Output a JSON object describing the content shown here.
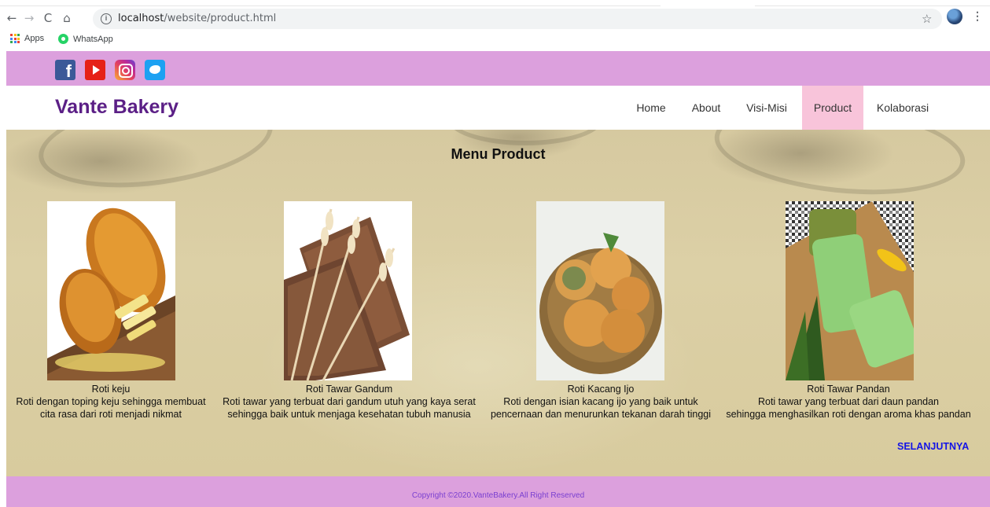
{
  "browser": {
    "url_host": "localhost",
    "url_path": "/website/product.html",
    "bookmarks": [
      {
        "label": "Apps"
      },
      {
        "label": "WhatsApp"
      }
    ]
  },
  "site": {
    "brand": "Vante Bakery",
    "nav": [
      {
        "label": "Home"
      },
      {
        "label": "About"
      },
      {
        "label": "Visi-Misi"
      },
      {
        "label": "Product"
      },
      {
        "label": "Kolaborasi"
      }
    ],
    "active_nav": "Product",
    "colors": {
      "top_bar": "#dca0dd",
      "brand": "#5b1f86",
      "active_nav": "#f8c4da",
      "link": "#1414e6"
    },
    "heading": "Menu Product",
    "products": [
      {
        "name": "Roti keju",
        "line1": "Roti dengan toping keju sehingga membuat",
        "line2": "cita rasa dari roti menjadi nikmat"
      },
      {
        "name": "Roti Tawar Gandum",
        "line1": "Roti tawar yang terbuat dari gandum utuh yang kaya serat",
        "line2": "sehingga baik untuk menjaga kesehatan tubuh manusia"
      },
      {
        "name": "Roti Kacang Ijo",
        "line1": "Roti dengan isian kacang ijo yang baik untuk",
        "line2": "pencernaan dan menurunkan tekanan darah tinggi"
      },
      {
        "name": "Roti Tawar Pandan",
        "line1": "Roti tawar yang terbuat dari daun pandan",
        "line2": "sehingga menghasilkan roti dengan aroma khas pandan"
      }
    ],
    "next_label": "SELANJUTNYA",
    "copyright": "Copyright ©2020.VanteBakery.All Right Reserved"
  }
}
